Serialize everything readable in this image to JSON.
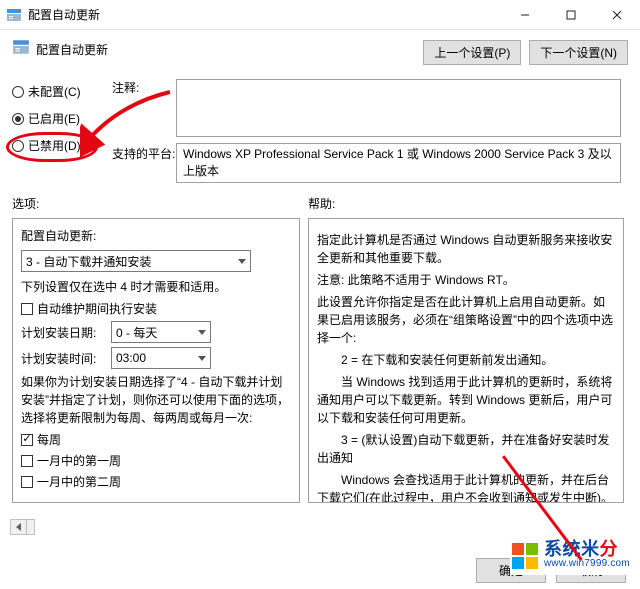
{
  "window": {
    "title": "配置自动更新",
    "minimize_label": "Minimize",
    "maximize_label": "Maximize",
    "close_label": "Close"
  },
  "header": {
    "title": "配置自动更新",
    "prev_button": "上一个设置(P)",
    "next_button": "下一个设置(N)"
  },
  "state_radios": {
    "not_configured": "未配置(C)",
    "enabled": "已启用(E)",
    "disabled": "已禁用(D)",
    "selected": "enabled"
  },
  "labels": {
    "comment": "注释:",
    "supported_on": "支持的平台:",
    "options": "选项:",
    "help": "帮助:"
  },
  "supported_on_text": "Windows XP Professional Service Pack 1 或 Windows 2000 Service Pack 3 及以上版本",
  "options": {
    "group_label": "配置自动更新:",
    "mode_select": "3 - 自动下载并通知安装",
    "mode4_note": "下列设置仅在选中 4 时才需要和适用。",
    "cb_maintenance": "自动维护期间执行安装",
    "install_day_label": "计划安装日期:",
    "install_day_value": "0 - 每天",
    "install_time_label": "计划安装时间:",
    "install_time_value": "03:00",
    "mode4_para": "如果你为计划安装日期选择了“4 - 自动下载并计划安装”并指定了计划，则你还可以使用下面的选项，选择将更新限制为每周、每两周或每月一次:",
    "cb_every_week": "每周",
    "cb_first_week": "一月中的第一周",
    "cb_second_week_partial": "一月中的第二周"
  },
  "help_text": {
    "p1": "指定此计算机是否通过 Windows 自动更新服务来接收安全更新和其他重要下载。",
    "p2": "注意: 此策略不适用于 Windows RT。",
    "p3": "此设置允许你指定是否在此计算机上启用自动更新。如果已启用该服务，必须在“组策略设置”中的四个选项中选择一个:",
    "p4": "　　2 = 在下载和安装任何更新前发出通知。",
    "p5": "　　当 Windows 找到适用于此计算机的更新时，系统将通知用户可以下载更新。转到 Windows 更新后，用户可以下载和安装任何可用更新。",
    "p6": "　　3 = (默认设置)自动下载更新，并在准备好安装时发出通知",
    "p7": "　　Windows 会查找适用于此计算机的更新，并在后台下载它们(在此过程中，用户不会收到通知或发生中断)。下载完成后，系统将通知用户他们已准备好进行安装。转到 Windows 更新后，用户即可安装它"
  },
  "footer": {
    "ok": "确定",
    "cancel": "取消"
  },
  "brand": {
    "main_a": "系统米",
    "main_b": "分",
    "sub": "www.win7999.com"
  }
}
